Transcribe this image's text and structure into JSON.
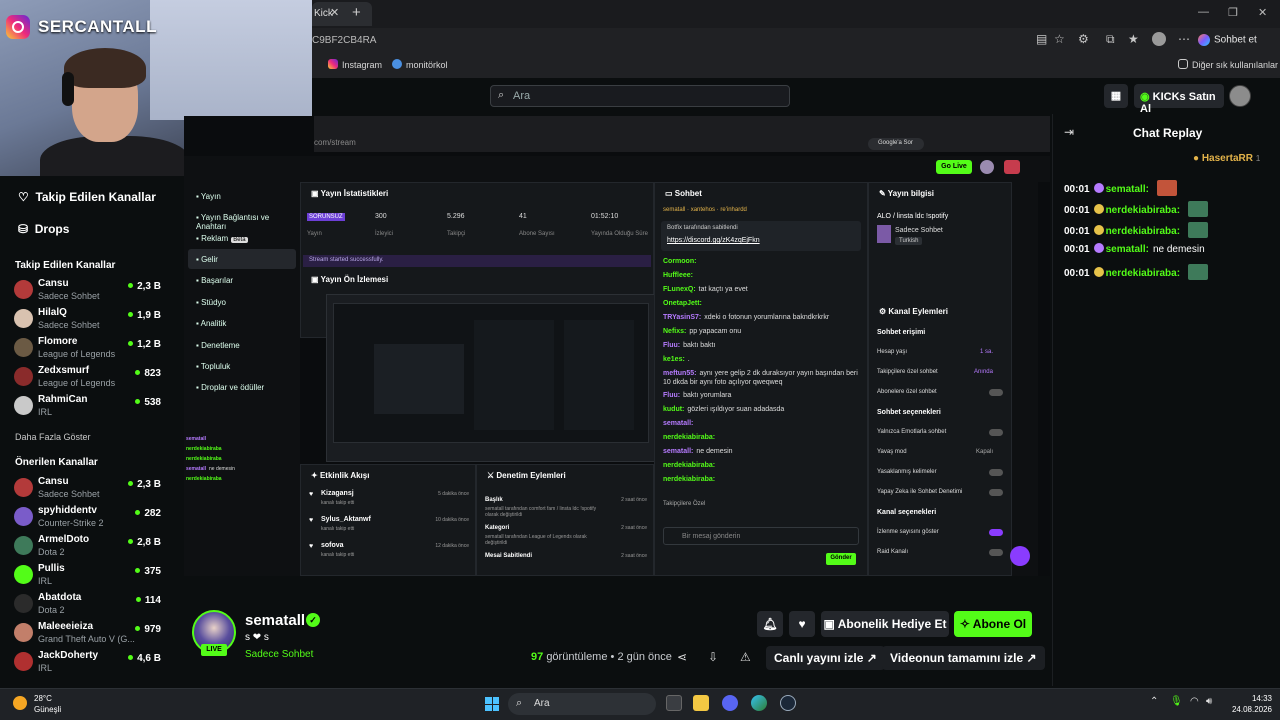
{
  "browser": {
    "tab_title": "Kick",
    "address": "C9BF2CB4RA",
    "copilot_label": "Sohbet et",
    "bookmarks": [
      "Instagram",
      "monitörkol"
    ],
    "other_favorites": "Diğer sık kullanılanlar"
  },
  "overlay": {
    "streamer_handle": "SERCANTALL"
  },
  "header": {
    "search_placeholder": "Ara",
    "buy_kicks": "KICKs Satın Al"
  },
  "sidebar": {
    "nav": [
      {
        "label": "Takip Edilen Kanallar",
        "icon": "heart-icon"
      },
      {
        "label": "Drops",
        "icon": "drops-icon"
      }
    ],
    "followed_title": "Takip Edilen Kanallar",
    "followed": [
      {
        "name": "Cansu",
        "sub": "Sadece Sohbet",
        "count": "2,3 B",
        "color": "#b33a3a"
      },
      {
        "name": "HilalQ",
        "sub": "Sadece Sohbet",
        "count": "1,9 B",
        "color": "#d9c2b0"
      },
      {
        "name": "Flomore",
        "sub": "League of Legends",
        "count": "1,2 B",
        "color": "#6b5a44"
      },
      {
        "name": "Zedxsmurf",
        "sub": "League of Legends",
        "count": "823",
        "color": "#8a2b2b"
      },
      {
        "name": "RahmiCan",
        "sub": "IRL",
        "count": "538",
        "color": "#c9c9c9"
      }
    ],
    "show_more": "Daha Fazla Göster",
    "recommended_title": "Önerilen Kanallar",
    "recommended": [
      {
        "name": "Cansu",
        "sub": "Sadece Sohbet",
        "count": "2,3 B",
        "color": "#b33a3a"
      },
      {
        "name": "spyhiddentv",
        "sub": "Counter-Strike 2",
        "count": "282",
        "color": "#7a5cc9"
      },
      {
        "name": "ArmelDoto",
        "sub": "Dota 2",
        "count": "2,8 B",
        "color": "#3e7a5a"
      },
      {
        "name": "Pullis",
        "sub": "IRL",
        "count": "375",
        "color": "#53fc18"
      },
      {
        "name": "Abatdota",
        "sub": "Dota 2",
        "count": "114",
        "color": "#2b2b2b"
      },
      {
        "name": "Maleeeieiza",
        "sub": "Grand Theft Auto V (G...",
        "count": "979",
        "color": "#c27f6a"
      },
      {
        "name": "JackDoherty",
        "sub": "IRL",
        "count": "4,6 B",
        "color": "#b03030"
      }
    ]
  },
  "video": {
    "inner_url": "com/stream",
    "inner_google": "Google'a Sor",
    "go_live": "Go Live",
    "dash_menu": [
      "Yayın",
      "Yayın Bağlantısı ve Anahtarı",
      "Reklam",
      "Gelir",
      "Başarılar",
      "Stüdyo",
      "Analitik",
      "Denetleme",
      "Topluluk",
      "Droplar ve ödüller"
    ],
    "dash_beta": "Beta",
    "stats_title": "Yayın İstatistikleri",
    "stats": [
      {
        "value": "SORUNSUZ",
        "label": "Yayın"
      },
      {
        "value": "300",
        "label": "İzleyici"
      },
      {
        "value": "5.296",
        "label": "Takipçi"
      },
      {
        "value": "41",
        "label": "Abone Sayısı"
      },
      {
        "value": "01:52:10",
        "label": "Yayında Olduğu Süre"
      }
    ],
    "stream_started": "Stream started successfully.",
    "preview_title": "Yayın Ön İzlemesi",
    "activity_title": "Etkinlik Akışı",
    "activity": [
      {
        "name": "Kizagansj",
        "desc": "kanalı takip etti",
        "time": "5 dakika önce"
      },
      {
        "name": "Sylus_Aktanwf",
        "desc": "kanalı takip etti",
        "time": "10 dakika önce"
      },
      {
        "name": "sofova",
        "desc": "kanalı takip etti",
        "time": "12 dakika önce"
      }
    ],
    "mod_title": "Denetim Eylemleri",
    "mod": [
      {
        "name": "Başlık",
        "desc": "sematall tarafından comfort fam / linsta ldc !spotify olarak değiştirildi",
        "time": "2 saat önce"
      },
      {
        "name": "Kategori",
        "desc": "sematall tarafından League of Legends olarak değiştirildi",
        "time": "2 saat önce"
      },
      {
        "name": "Mesai Sabitlendi",
        "desc": "",
        "time": "2 saat önce"
      }
    ],
    "chat_title": "Sohbet",
    "chat_top": [
      "sematall",
      "xantehos",
      "re'inhardd"
    ],
    "chat_pinned_by": "Botfix tarafından sabitlendi",
    "chat_pinned_link": "https://discord.gg/zK4zqEjFkn",
    "chat_lines": [
      {
        "user": "Cormoon:",
        "text": "",
        "style": "g"
      },
      {
        "user": "Huffleee:",
        "text": "",
        "style": "g"
      },
      {
        "user": "FLunexQ:",
        "text": "tat kaçtı ya evet",
        "style": "g"
      },
      {
        "user": "OnetapJett:",
        "text": "",
        "style": "g"
      },
      {
        "user": "TRYasinS7:",
        "text": "xdeki o fotonun yorumlarına bakndkrkrkr",
        "style": "p"
      },
      {
        "user": "Nefixs:",
        "text": "pp yapacam onu",
        "style": "g"
      },
      {
        "user": "Fluu:",
        "text": "baktı baktı",
        "style": "p"
      },
      {
        "user": "ke1es:",
        "text": ".",
        "style": "g"
      },
      {
        "user": "meftun55:",
        "text": "aynı yere gelip 2 dk duraksıyor yayın başından beri 10 dkda bir aynı foto açılıyor qweqweq",
        "style": "p"
      },
      {
        "user": "Fluu:",
        "text": "baktı yorumlara",
        "style": "p"
      },
      {
        "user": "kudut:",
        "text": "gözleri ışıldıyor suan adadasda",
        "style": "g"
      },
      {
        "user": "sematall:",
        "text": "",
        "style": "p"
      },
      {
        "user": "nerdekiabiraba:",
        "text": "",
        "style": "g"
      },
      {
        "user": "sematall:",
        "text": "ne demesin",
        "style": "p"
      },
      {
        "user": "nerdekiabiraba:",
        "text": "",
        "style": "g"
      },
      {
        "user": "nerdekiabiraba:",
        "text": "",
        "style": "g"
      }
    ],
    "chat_followers_only": "Takipçilere Özel",
    "chat_input": "Bir mesaj gönderin",
    "chat_send": "Gönder",
    "info_title": "Yayın bilgisi",
    "info_stream_title": "ALO / linsta ldc !spotify",
    "info_category": "Sadece Sohbet",
    "info_tag": "Turkish",
    "channel_actions_title": "Kanal Eylemleri",
    "settings": [
      {
        "section": "Sohbet erişimi"
      },
      {
        "label": "Hesap yaşı",
        "value": "1 sa."
      },
      {
        "label": "Takipçilere özel sohbet",
        "value": "Anında"
      },
      {
        "label": "Abonelere özel sohbet",
        "value": ""
      },
      {
        "section": "Sohbet seçenekleri"
      },
      {
        "label": "Yalnızca Emotlarla sohbet",
        "value": ""
      },
      {
        "label": "Yavaş mod",
        "value": "Kapalı"
      },
      {
        "label": "Yasaklanmış kelimeler",
        "value": ""
      },
      {
        "label": "Yapay Zeka ile Sohbet Denetimi",
        "value": ""
      },
      {
        "section": "Kanal seçenekleri"
      },
      {
        "label": "İzlenme sayısını göster",
        "value": ""
      },
      {
        "label": "Raid Kanalı",
        "value": ""
      }
    ],
    "left_mini_chat": [
      {
        "user": "sematall",
        "text": ""
      },
      {
        "user": "nerdekiabiraba",
        "text": ""
      },
      {
        "user": "nerdekiabiraba",
        "text": ""
      },
      {
        "user": "sematall",
        "text": "ne demesin"
      },
      {
        "user": "nerdekiabiraba",
        "text": ""
      }
    ]
  },
  "stream": {
    "name": "sematall",
    "title": "s ❤ s",
    "category": "Sadece Sohbet",
    "live": "LIVE",
    "views_count": "97",
    "views_label": "görüntüleme",
    "ago": "• 2 gün önce",
    "gift_sub": "Abonelik Hediye Et",
    "subscribe": "Abone Ol",
    "watch_live": "Canlı yayını izle",
    "watch_full": "Videonun tamamını izle"
  },
  "chat_replay": {
    "title": "Chat Replay",
    "pinned_user": "HasertaRR",
    "pinned_count": "1",
    "lines": [
      {
        "time": "00:01",
        "user": "sematall:",
        "text": "",
        "badge": "#b67bff",
        "emote": "#c2543a"
      },
      {
        "time": "00:01",
        "user": "nerdekiabiraba:",
        "text": "",
        "badge": "#e7c34a",
        "emote": "#3e7a5a"
      },
      {
        "time": "00:01",
        "user": "nerdekiabiraba:",
        "text": "",
        "badge": "#e7c34a",
        "emote": "#3e7a5a"
      },
      {
        "time": "00:01",
        "user": "sematall:",
        "text": "ne demesin",
        "badge": "#b67bff",
        "emote": ""
      },
      {
        "time": "00:01",
        "user": "nerdekiabiraba:",
        "text": "",
        "badge": "#e7c34a",
        "emote": "#3e7a5a"
      }
    ]
  },
  "taskbar": {
    "temp": "28°C",
    "weather": "Güneşli",
    "search": "Ara",
    "time": "14:33",
    "date": "24.08.2026"
  },
  "colors": {
    "kick_green": "#53fc18",
    "purple": "#b67bff",
    "bg": "#0b0e0f"
  }
}
